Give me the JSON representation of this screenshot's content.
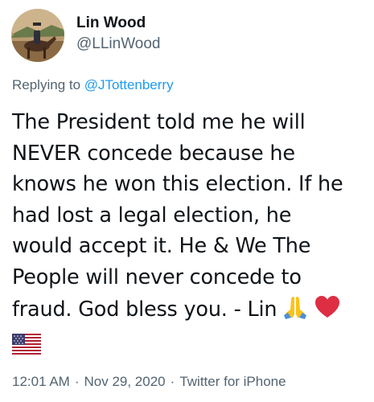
{
  "author": {
    "name": "Lin Wood",
    "handle": "@LLinWood"
  },
  "reply": {
    "prefix": "Replying to ",
    "to_handle": "@JTottenberry"
  },
  "tweet": {
    "lines": [
      "The President told me he will",
      "NEVER concede because he",
      "knows he won this election. If he",
      "had lost a legal election, he",
      "would accept it. He & We The",
      "People will never concede to",
      "fraud. God bless you. - Lin"
    ],
    "emojis": [
      "folded-hands-icon",
      "red-heart-icon",
      "us-flag-icon"
    ]
  },
  "meta": {
    "time": "12:01 AM",
    "date": "Nov 29, 2020",
    "separator": "·",
    "source": "Twitter for iPhone"
  },
  "colors": {
    "link": "#1d9bf0",
    "secondary_text": "#536471",
    "primary_text": "#0f1419"
  }
}
